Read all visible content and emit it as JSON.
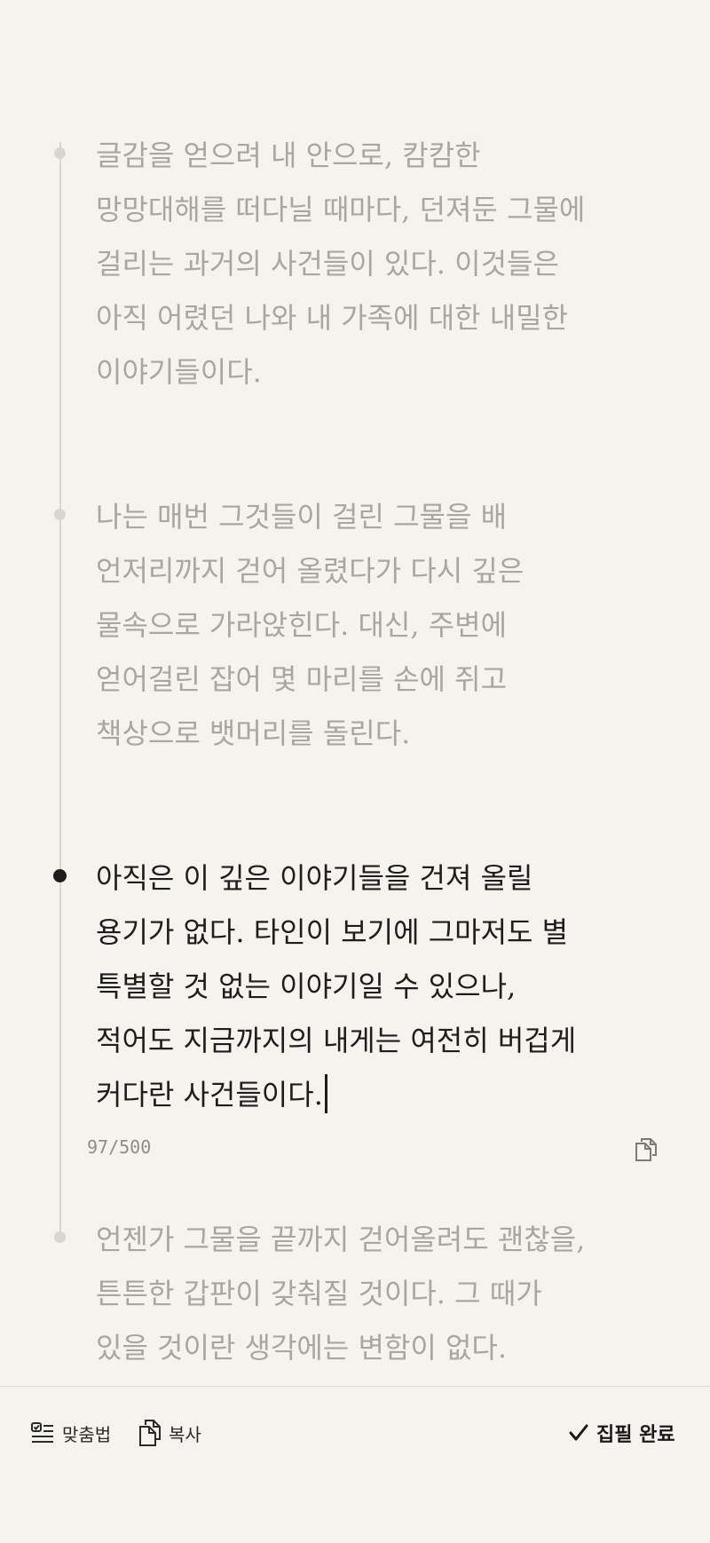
{
  "paragraphs": [
    {
      "lines": [
        "글감을 얻으려 내 안으로, 캄캄한",
        "망망대해를 떠다닐 때마다, 던져둔 그물에",
        "걸리는 과거의 사건들이 있다. 이것들은",
        "아직 어렸던 나와 내 가족에 대한 내밀한",
        "이야기들이다."
      ],
      "active": false
    },
    {
      "lines": [
        "나는 매번 그것들이 걸린 그물을 배",
        "언저리까지 걷어 올렸다가 다시 깊은",
        "물속으로 가라앉힌다. 대신, 주변에",
        "얻어걸린 잡어 몇 마리를 손에 쥐고",
        "책상으로 뱃머리를 돌린다."
      ],
      "active": false
    },
    {
      "lines": [
        "아직은 이 깊은 이야기들을 건져 올릴",
        "용기가 없다. 타인이 보기에 그마저도 별",
        "특별할 것 없는 이야기일 수 있으나,",
        "적어도 지금까지의 내게는 여전히 버겁게",
        "커다란 사건들이다."
      ],
      "active": true
    },
    {
      "lines": [
        "언젠가 그물을 끝까지 걷어올려도 괜찮을,",
        "튼튼한 갑판이 갖춰질 것이다. 그 때가",
        "있을 것이란 생각에는 변함이 없다."
      ],
      "active": false
    }
  ],
  "editor": {
    "char_count": "97/500",
    "copy_icon": "copy-icon"
  },
  "toolbar": {
    "spellcheck_label": "맞춤법",
    "spellcheck_icon": "spellcheck-icon",
    "copy_label": "복사",
    "copy_icon": "copy-icon",
    "done_label": "집필 완료",
    "done_icon": "checkmark-icon"
  },
  "colors": {
    "background": "#f6f3ee",
    "active_text": "#1e1d1b",
    "inactive_text": "#a9a6a2",
    "timeline": "#d9d6d1"
  }
}
